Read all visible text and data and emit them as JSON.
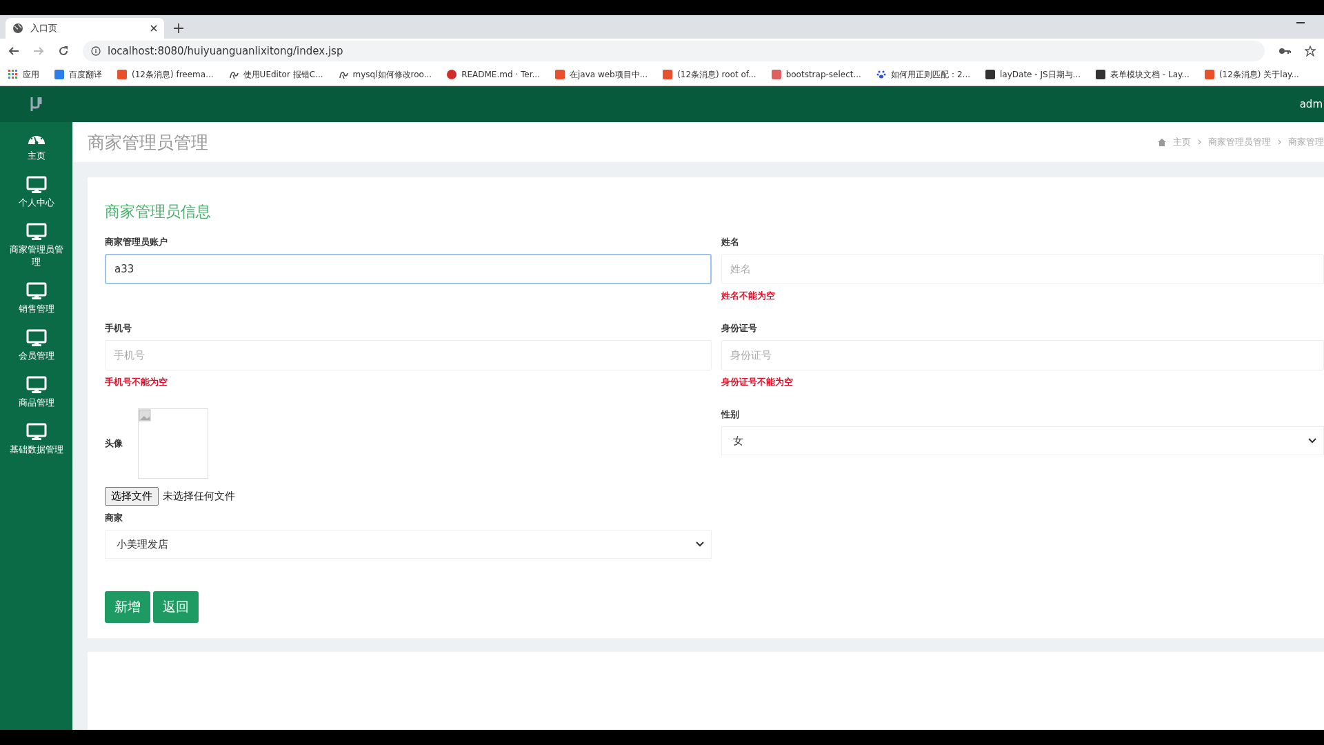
{
  "browser": {
    "tab": {
      "title": "入口页"
    },
    "address": "localhost:8080/huiyuanguanlixitong/index.jsp",
    "bookmarks": [
      {
        "label": "应用",
        "kind": "apps"
      },
      {
        "label": "百度翻译",
        "kind": "square",
        "color": "#2b7de9"
      },
      {
        "label": "(12条消息) freema...",
        "kind": "square",
        "color": "#e8512b"
      },
      {
        "label": "使用UEditor 报错C...",
        "kind": "glyph"
      },
      {
        "label": "mysql如何修改roo...",
        "kind": "glyph"
      },
      {
        "label": "README.md · Ter...",
        "kind": "round",
        "color": "#d42a2a"
      },
      {
        "label": "在java web项目中...",
        "kind": "square",
        "color": "#e8512b"
      },
      {
        "label": "(12条消息) root of...",
        "kind": "square",
        "color": "#e8512b"
      },
      {
        "label": "bootstrap-select...",
        "kind": "square",
        "color": "#e06060"
      },
      {
        "label": "如何用正则匹配：2...",
        "kind": "paw"
      },
      {
        "label": "layDate - JS日期与...",
        "kind": "square",
        "color": "#333333"
      },
      {
        "label": "表单模块文档 - Lay...",
        "kind": "square",
        "color": "#333333"
      },
      {
        "label": "(12条消息) 关于lay...",
        "kind": "square",
        "color": "#e8512b"
      }
    ]
  },
  "header": {
    "user": "adm"
  },
  "sidebar": {
    "items": [
      {
        "label": "主页",
        "kind": "dashboard"
      },
      {
        "label": "个人中心",
        "kind": "monitor"
      },
      {
        "label": "商家管理员管理",
        "kind": "monitor"
      },
      {
        "label": "销售管理",
        "kind": "monitor"
      },
      {
        "label": "会员管理",
        "kind": "monitor"
      },
      {
        "label": "商品管理",
        "kind": "monitor"
      },
      {
        "label": "基础数据管理",
        "kind": "monitor"
      }
    ]
  },
  "page": {
    "title": "商家管理员管理",
    "breadcrumb": [
      "主页",
      "商家管理员管理",
      "商家管理"
    ]
  },
  "form": {
    "title": "商家管理员信息",
    "left": [
      {
        "kind": "text",
        "label": "商家管理员账户",
        "value": "a33",
        "focused": true
      },
      {
        "kind": "text",
        "label": "手机号",
        "placeholder": "手机号",
        "error": "手机号不能为空",
        "focused": false
      },
      {
        "kind": "image",
        "label": "头像",
        "button": "选择文件",
        "status": "未选择任何文件"
      },
      {
        "kind": "select",
        "label": "商家",
        "value": "小美理发店"
      }
    ],
    "right": [
      {
        "kind": "text",
        "label": "姓名",
        "placeholder": "姓名",
        "error": "姓名不能为空",
        "focused": false
      },
      {
        "kind": "text",
        "label": "身份证号",
        "placeholder": "身份证号",
        "error": "身份证号不能为空",
        "focused": false
      },
      {
        "kind": "select",
        "label": "性别",
        "value": "女"
      }
    ],
    "buttons": [
      "新增",
      "返回"
    ]
  }
}
